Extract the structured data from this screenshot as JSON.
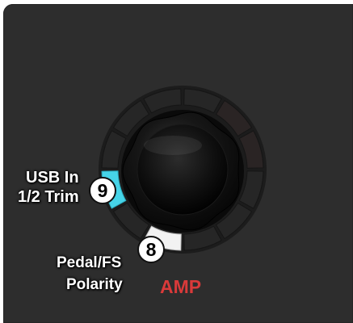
{
  "device": {
    "knob_labels": {
      "usb_in_line1": "USB In",
      "usb_in_line2": "1/2 Trim",
      "pedal_line1": "Pedal/FS",
      "pedal_line2": "Polarity",
      "amp": "AMP"
    },
    "callouts": {
      "usb_trim_number": "9",
      "pedal_polarity_number": "8"
    },
    "colors": {
      "panel": "#2d2d2d",
      "usb_segment_active": "#46d4e8",
      "pedal_segment_active": "#f2f2f2",
      "amp_text": "#d93a3a"
    },
    "icons": {
      "knob": "rotary-encoder-knob"
    }
  }
}
